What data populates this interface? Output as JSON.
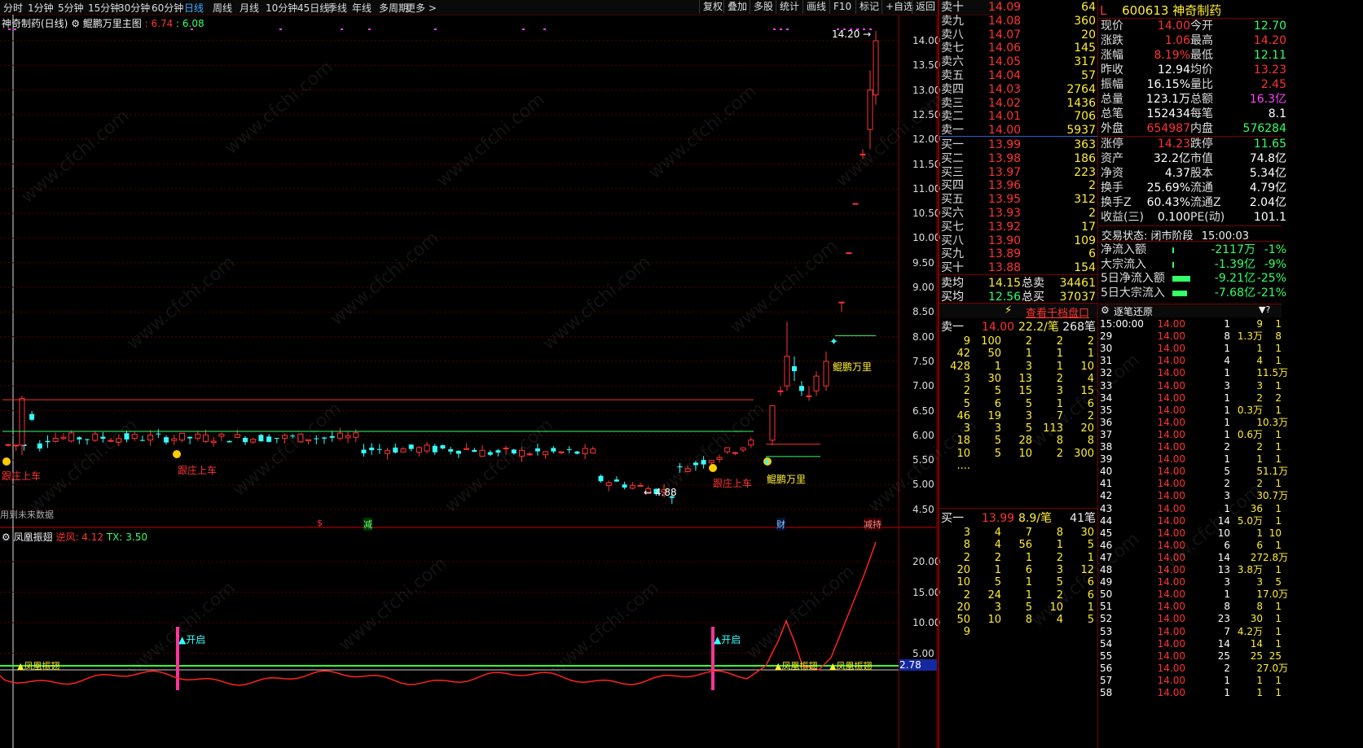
{
  "toolbar": {
    "timeframes": [
      "分时",
      "1分钟",
      "5分钟",
      "15分钟",
      "30分钟",
      "60分钟",
      "日线",
      "周线",
      "月线",
      "10分钟",
      "45日线",
      "季线",
      "年线",
      "多周期",
      "更多 >"
    ],
    "active": "日线",
    "tools": [
      "复权",
      "叠加",
      "多股",
      "统计",
      "画线",
      "F10",
      "标记",
      "+自选",
      "返回"
    ]
  },
  "main_chart": {
    "stock_title": "神奇制药(日线)",
    "indicator_name": "鲲鹏万里主图",
    "ind_v1": "6.74",
    "ind_v2": "6.08",
    "y_ticks": [
      "14.00",
      "13.50",
      "13.00",
      "12.50",
      "12.00",
      "11.50",
      "11.00",
      "10.50",
      "10.00",
      "9.50",
      "9.00",
      "8.50",
      "8.00",
      "7.50",
      "7.00",
      "6.50",
      "6.00",
      "5.50",
      "5.00",
      "4.50"
    ],
    "high_label": "14.20",
    "low_label": "4.88",
    "tag1": "跟庄上车",
    "tag2": "跟庄上车",
    "tag3": "跟庄上车",
    "tag4": "鲲鹏万里",
    "tag5": "鲲鹏万里",
    "future_note": "用到未来数据",
    "event1": "$",
    "event2": "减",
    "event3": "财",
    "event4": "减持"
  },
  "sub_chart": {
    "name": "凤凰振翅",
    "v1_label": "逆风: 4.12",
    "v2_label": "TX: 3.50",
    "y_ticks": [
      "20.00",
      "15.00",
      "10.00",
      "5.00"
    ],
    "current_value": "2.78",
    "open1": "开启",
    "open2": "开启",
    "sig1": "凤凰振翅",
    "sig2": "凤凰振翅",
    "sig3": "凤凰振翅"
  },
  "orderbook": {
    "asks": [
      {
        "label": "卖十",
        "price": "14.09",
        "vol": "64"
      },
      {
        "label": "卖九",
        "price": "14.08",
        "vol": "360"
      },
      {
        "label": "卖八",
        "price": "14.07",
        "vol": "20"
      },
      {
        "label": "卖七",
        "price": "14.06",
        "vol": "145"
      },
      {
        "label": "卖六",
        "price": "14.05",
        "vol": "317"
      },
      {
        "label": "卖五",
        "price": "14.04",
        "vol": "57"
      },
      {
        "label": "卖四",
        "price": "14.03",
        "vol": "2764"
      },
      {
        "label": "卖三",
        "price": "14.02",
        "vol": "1436"
      },
      {
        "label": "卖二",
        "price": "14.01",
        "vol": "706"
      },
      {
        "label": "卖一",
        "price": "14.00",
        "vol": "5937"
      }
    ],
    "bids": [
      {
        "label": "买一",
        "price": "13.99",
        "vol": "363"
      },
      {
        "label": "买二",
        "price": "13.98",
        "vol": "186"
      },
      {
        "label": "买三",
        "price": "13.97",
        "vol": "223"
      },
      {
        "label": "买四",
        "price": "13.96",
        "vol": "2"
      },
      {
        "label": "买五",
        "price": "13.95",
        "vol": "312"
      },
      {
        "label": "买六",
        "price": "13.93",
        "vol": "2"
      },
      {
        "label": "买七",
        "price": "13.92",
        "vol": "17"
      },
      {
        "label": "买八",
        "price": "13.90",
        "vol": "109"
      },
      {
        "label": "买九",
        "price": "13.89",
        "vol": "6"
      },
      {
        "label": "买十",
        "price": "13.88",
        "vol": "154"
      }
    ],
    "avg_ask_label": "卖均",
    "avg_ask": "14.15",
    "total_ask_label": "总卖",
    "total_ask": "34461",
    "avg_bid_label": "买均",
    "avg_bid": "12.56",
    "total_bid_label": "总买",
    "total_bid": "37037",
    "view_depth": "查看千档盘口",
    "ask1_label": "卖一",
    "ask1_price": "14.00",
    "ask1_per": "22.2/笔",
    "ask1_cnt": "268笔",
    "bid1_label": "买一",
    "bid1_price": "13.99",
    "bid1_per": "8.9/笔",
    "bid1_cnt": "41笔",
    "ask_queue": [
      [
        "9",
        "100",
        "2",
        "2",
        "2"
      ],
      [
        "42",
        "50",
        "1",
        "1",
        "1"
      ],
      [
        "428",
        "1",
        "3",
        "1",
        "10"
      ],
      [
        "3",
        "30",
        "13",
        "2",
        "4"
      ],
      [
        "2",
        "5",
        "15",
        "3",
        "15"
      ],
      [
        "5",
        "6",
        "5",
        "1",
        "6"
      ],
      [
        "46",
        "19",
        "3",
        "7",
        "2"
      ],
      [
        "3",
        "3",
        "5",
        "113",
        "20"
      ],
      [
        "18",
        "5",
        "28",
        "8",
        "8"
      ],
      [
        "10",
        "5",
        "10",
        "2",
        "300"
      ],
      [
        "....",
        "",
        "",
        "",
        ""
      ]
    ],
    "bid_queue": [
      [
        "3",
        "4",
        "7",
        "8",
        "30"
      ],
      [
        "8",
        "4",
        "56",
        "1",
        "5"
      ],
      [
        "2",
        "2",
        "1",
        "2",
        "1"
      ],
      [
        "20",
        "1",
        "6",
        "3",
        "12"
      ],
      [
        "10",
        "5",
        "1",
        "5",
        "6"
      ],
      [
        "2",
        "24",
        "1",
        "2",
        "6"
      ],
      [
        "20",
        "3",
        "5",
        "10",
        "1"
      ],
      [
        "50",
        "10",
        "8",
        "4",
        "5"
      ],
      [
        "9",
        "",
        "",
        "",
        ""
      ]
    ]
  },
  "quote": {
    "market": "L",
    "code": "600613",
    "name": "神奇制药",
    "rows": [
      [
        "现价",
        "14.00",
        "今开",
        "12.70"
      ],
      [
        "涨跌",
        "1.06",
        "最高",
        "14.20"
      ],
      [
        "涨幅",
        "8.19%",
        "最低",
        "12.11"
      ],
      [
        "昨收",
        "12.94",
        "均价",
        "13.23"
      ],
      [
        "振幅",
        "16.15%",
        "量比",
        "2.45"
      ],
      [
        "总量",
        "123.1万",
        "总额",
        "16.3亿"
      ],
      [
        "总笔",
        "152434",
        "每笔",
        "8.1"
      ],
      [
        "外盘",
        "654987",
        "内盘",
        "576284"
      ]
    ],
    "rows2": [
      [
        "涨停",
        "14.23",
        "跌停",
        "11.65"
      ],
      [
        "资产",
        "32.2亿",
        "市值",
        "74.8亿"
      ],
      [
        "净资",
        "4.37",
        "股本",
        "5.34亿"
      ],
      [
        "换手",
        "25.69%",
        "流通",
        "4.79亿"
      ],
      [
        "换手Z",
        "60.43%",
        "流通Z",
        "2.04亿"
      ],
      [
        "收益(三)",
        "0.100",
        "PE(动)",
        "101.1"
      ]
    ],
    "status_label": "交易状态:",
    "status": "闭市阶段",
    "status_time": "15:00:03",
    "flows": [
      {
        "label": "净流入额",
        "val": "-2117万",
        "pct": "-1%"
      },
      {
        "label": "大宗流入",
        "val": "-1.39亿",
        "pct": "-9%"
      },
      {
        "label": "5日净流入额",
        "val": "-9.21亿",
        "pct": "-25%"
      },
      {
        "label": "5日大宗流入",
        "val": "-7.68亿",
        "pct": "-21%"
      }
    ]
  },
  "trades": {
    "title": "逐笔还原",
    "rows": [
      [
        "15:00:00",
        "14.00",
        "1",
        "9",
        "1"
      ],
      [
        "29",
        "14.00",
        "8",
        "1.3万",
        "8"
      ],
      [
        "30",
        "14.00",
        "1",
        "1",
        "1"
      ],
      [
        "31",
        "14.00",
        "4",
        "4",
        "1"
      ],
      [
        "32",
        "14.00",
        "1",
        "1",
        "1.5万"
      ],
      [
        "33",
        "14.00",
        "3",
        "3",
        "1"
      ],
      [
        "34",
        "14.00",
        "1",
        "2",
        "2"
      ],
      [
        "35",
        "14.00",
        "1",
        "0.3万",
        "1"
      ],
      [
        "36",
        "14.00",
        "1",
        "1",
        "0.3万"
      ],
      [
        "37",
        "14.00",
        "1",
        "0.6万",
        "1"
      ],
      [
        "38",
        "14.00",
        "2",
        "2",
        "1"
      ],
      [
        "39",
        "14.00",
        "1",
        "1",
        "1"
      ],
      [
        "40",
        "14.00",
        "5",
        "5",
        "1.1万"
      ],
      [
        "41",
        "14.00",
        "2",
        "2",
        "1"
      ],
      [
        "42",
        "14.00",
        "3",
        "3",
        "0.7万"
      ],
      [
        "43",
        "14.00",
        "1",
        "36",
        "1"
      ],
      [
        "44",
        "14.00",
        "14",
        "5.0万",
        "1"
      ],
      [
        "45",
        "14.00",
        "10",
        "1",
        "10"
      ],
      [
        "46",
        "14.00",
        "6",
        "6",
        "1"
      ],
      [
        "47",
        "14.00",
        "14",
        "27",
        "2.8万"
      ],
      [
        "48",
        "14.00",
        "13",
        "3.8万",
        "1"
      ],
      [
        "49",
        "14.00",
        "3",
        "3",
        "5"
      ],
      [
        "50",
        "14.00",
        "1",
        "1",
        "7.0万"
      ],
      [
        "51",
        "14.00",
        "8",
        "8",
        "1"
      ],
      [
        "52",
        "14.00",
        "23",
        "30",
        "1"
      ],
      [
        "53",
        "14.00",
        "7",
        "4.2万",
        "1"
      ],
      [
        "54",
        "14.00",
        "14",
        "14",
        "1"
      ],
      [
        "55",
        "14.00",
        "25",
        "25",
        "25"
      ],
      [
        "56",
        "14.00",
        "2",
        "2",
        "7.0万"
      ],
      [
        "57",
        "14.00",
        "1",
        "1",
        "1"
      ],
      [
        "58",
        "14.00",
        "1",
        "1",
        "1"
      ]
    ]
  },
  "watermark": "www.cfchi.com"
}
